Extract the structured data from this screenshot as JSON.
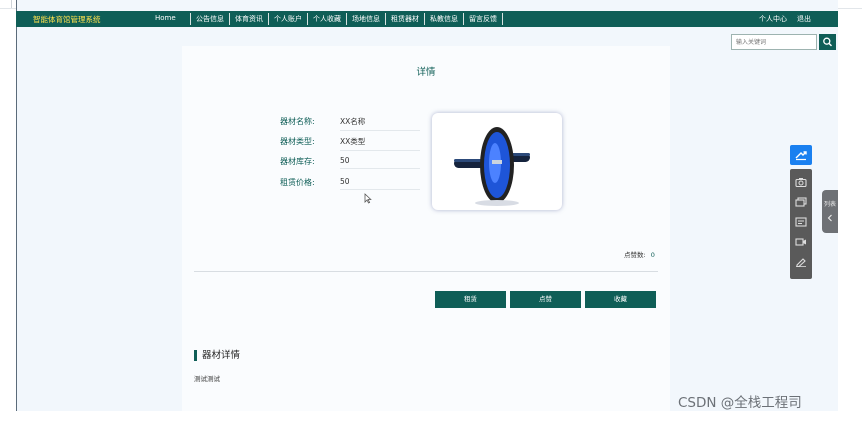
{
  "header": {
    "brand": "智能体育馆管理系统",
    "home": "Home",
    "menu": [
      "公告信息",
      "体育资讯",
      "个人账户",
      "个人收藏",
      "场地信息",
      "租赁器材",
      "私教信息",
      "留言反馈"
    ],
    "user_center": "个人中心",
    "logout": "退出"
  },
  "search": {
    "placeholder": "输入关键词"
  },
  "detail": {
    "title": "详情",
    "fields": [
      {
        "label": "器材名称:",
        "value": "XX名称"
      },
      {
        "label": "器材类型:",
        "value": "XX类型"
      },
      {
        "label": "器材库存:",
        "value": "50"
      },
      {
        "label": "租赁价格:",
        "value": "50"
      }
    ],
    "likes_label": "点赞数:",
    "likes_count": "0",
    "buttons": {
      "rent": "租赁",
      "like": "点赞",
      "collect": "收藏"
    },
    "section_title": "器材详情",
    "section_body": "测试测试"
  },
  "sidebar_tab": {
    "label": "列表"
  },
  "watermark": "CSDN @全栈工程司",
  "icons": {
    "search": "search-icon",
    "toolbar": [
      "share-icon",
      "camera-icon",
      "window-icon",
      "pdf-icon",
      "video-icon",
      "pen-icon"
    ],
    "collapse": "chevron-left-icon"
  },
  "colors": {
    "primary": "#0f5e57",
    "brand_text": "#ffe14d",
    "toolbar_active": "#1a80f0",
    "toolbar": "#5a5a5a"
  }
}
